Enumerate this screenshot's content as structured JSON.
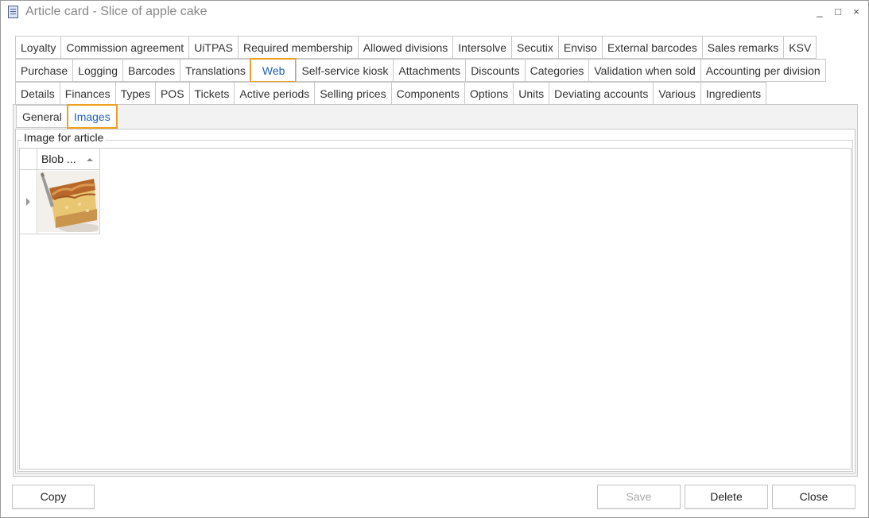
{
  "window": {
    "title": "Article card - Slice of apple cake",
    "icon": "document-list-icon",
    "controls": {
      "minimize": "_",
      "maximize": "□",
      "close": "×"
    }
  },
  "tabs": {
    "row1": [
      "Loyalty",
      "Commission agreement",
      "UiTPAS",
      "Required membership",
      "Allowed divisions",
      "Intersolve",
      "Secutix",
      "Enviso",
      "External barcodes",
      "Sales remarks",
      "KSV"
    ],
    "row2": [
      "Purchase",
      "Logging",
      "Barcodes",
      "Translations",
      "Web",
      "Self-service kiosk",
      "Attachments",
      "Discounts",
      "Categories",
      "Validation when sold",
      "Accounting per division"
    ],
    "row3": [
      "Details",
      "Finances",
      "Types",
      "POS",
      "Tickets",
      "Active periods",
      "Selling prices",
      "Components",
      "Options",
      "Units",
      "Deviating accounts",
      "Various",
      "Ingredients"
    ],
    "active": "Web"
  },
  "subtabs": {
    "items": [
      "General",
      "Images"
    ],
    "active": "Images"
  },
  "group": {
    "label": "Image for article",
    "grid": {
      "columns": [
        "Blob ..."
      ],
      "rows": [
        {
          "image": "apple-cake-slice-thumbnail"
        }
      ]
    }
  },
  "buttons": {
    "copy": "Copy",
    "save": "Save",
    "delete": "Delete",
    "close": "Close"
  },
  "colors": {
    "accent": "#1f5fbf",
    "highlight": "#f0a020"
  }
}
